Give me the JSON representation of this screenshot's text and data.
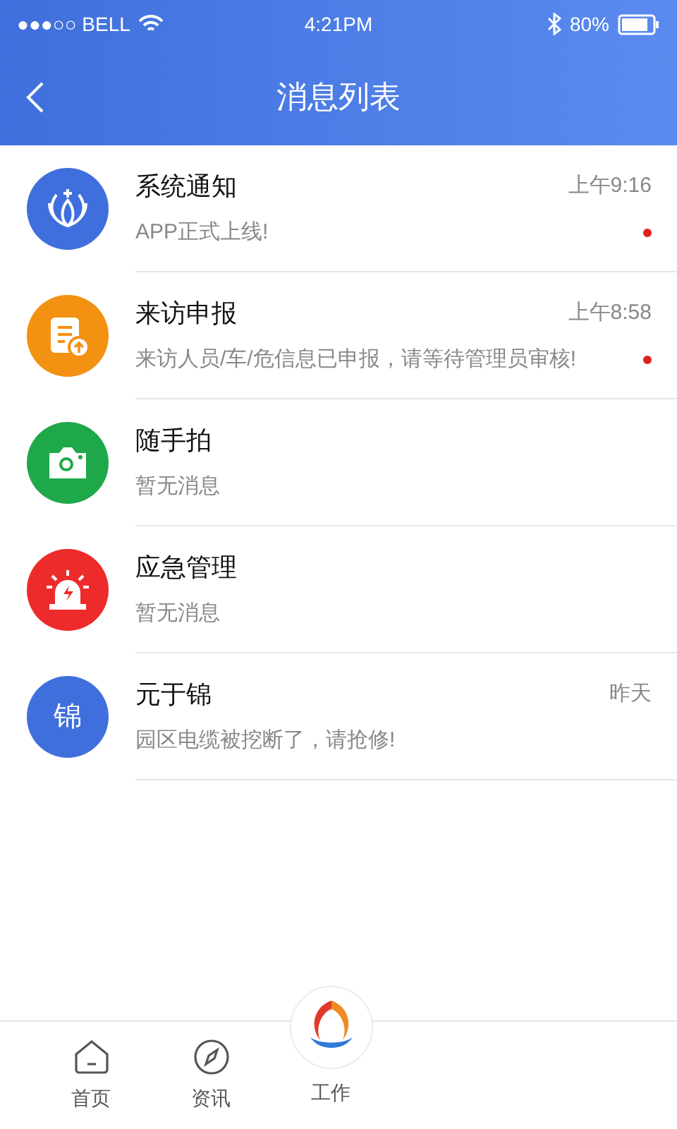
{
  "status_bar": {
    "carrier": "●●●○○ BELL",
    "time": "4:21PM",
    "battery": "80%"
  },
  "header": {
    "title": "消息列表"
  },
  "messages": [
    {
      "kind": "logo",
      "color": "#3f6fdc",
      "title": "系统通知",
      "preview": "APP正式上线!",
      "time": "上午9:16",
      "unread": true
    },
    {
      "kind": "form",
      "color": "#f39112",
      "title": "来访申报",
      "preview": "来访人员/车/危信息已申报，请等待管理员审核!",
      "time": "上午8:58",
      "unread": true
    },
    {
      "kind": "camera",
      "color": "#1fa84a",
      "title": "随手拍",
      "preview": "暂无消息",
      "unread": false
    },
    {
      "kind": "alarm",
      "color": "#ee2b2b",
      "title": "应急管理",
      "preview": "暂无消息",
      "unread": false
    },
    {
      "kind": "initial",
      "color": "#3f6fdc",
      "initial": "锦",
      "title": "元于锦",
      "preview": "园区电缆被挖断了，请抢修!",
      "time": "昨天",
      "unread": false
    }
  ],
  "tab_bar": [
    {
      "kind": "home",
      "label": "首页"
    },
    {
      "kind": "compass",
      "label": "资讯"
    },
    {
      "kind": "center",
      "label": "工作"
    }
  ]
}
